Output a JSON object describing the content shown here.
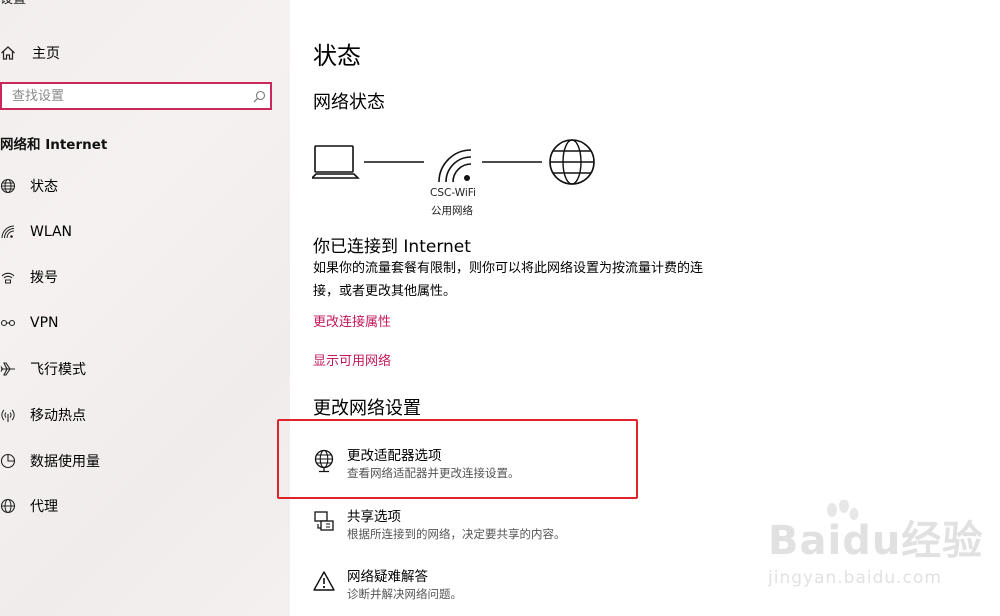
{
  "sidebar": {
    "title": "设置",
    "home_label": "主页",
    "search_placeholder": "查找设置",
    "section_title": "网络和 Internet",
    "items": [
      {
        "label": "状态",
        "icon": "globe-icon"
      },
      {
        "label": "WLAN",
        "icon": "wifi-icon"
      },
      {
        "label": "拨号",
        "icon": "dialup-icon"
      },
      {
        "label": "VPN",
        "icon": "vpn-icon"
      },
      {
        "label": "飞行模式",
        "icon": "airplane-icon"
      },
      {
        "label": "移动热点",
        "icon": "hotspot-icon"
      },
      {
        "label": "数据使用量",
        "icon": "data-usage-icon"
      },
      {
        "label": "代理",
        "icon": "globe-icon"
      }
    ]
  },
  "main": {
    "page_title": "状态",
    "network_status_heading": "网络状态",
    "wifi_name": "CSC-WiFi",
    "wifi_type": "公用网络",
    "connected_title": "你已连接到 Internet",
    "connected_desc": "如果你的流量套餐有限制，则你可以将此网络设置为按流量计费的连接，或者更改其他属性。",
    "links": {
      "change_props": "更改连接属性",
      "show_networks": "显示可用网络"
    },
    "change_settings_heading": "更改网络设置",
    "options": [
      {
        "title": "更改适配器选项",
        "desc": "查看网络适配器并更改连接设置。",
        "icon": "adapter-globe-icon"
      },
      {
        "title": "共享选项",
        "desc": "根据所连接到的网络，决定要共享的内容。",
        "icon": "sharing-icon"
      },
      {
        "title": "网络疑难解答",
        "desc": "诊断并解决网络问题。",
        "icon": "warning-icon"
      }
    ]
  },
  "watermark": {
    "logo_text": "Baidu经验",
    "url": "jingyan.baidu.com"
  },
  "colors": {
    "accent": "#c2185b",
    "search_border": "#c8285a",
    "highlight_box": "#e0222a",
    "sidebar_bg": "#f3eeee"
  }
}
